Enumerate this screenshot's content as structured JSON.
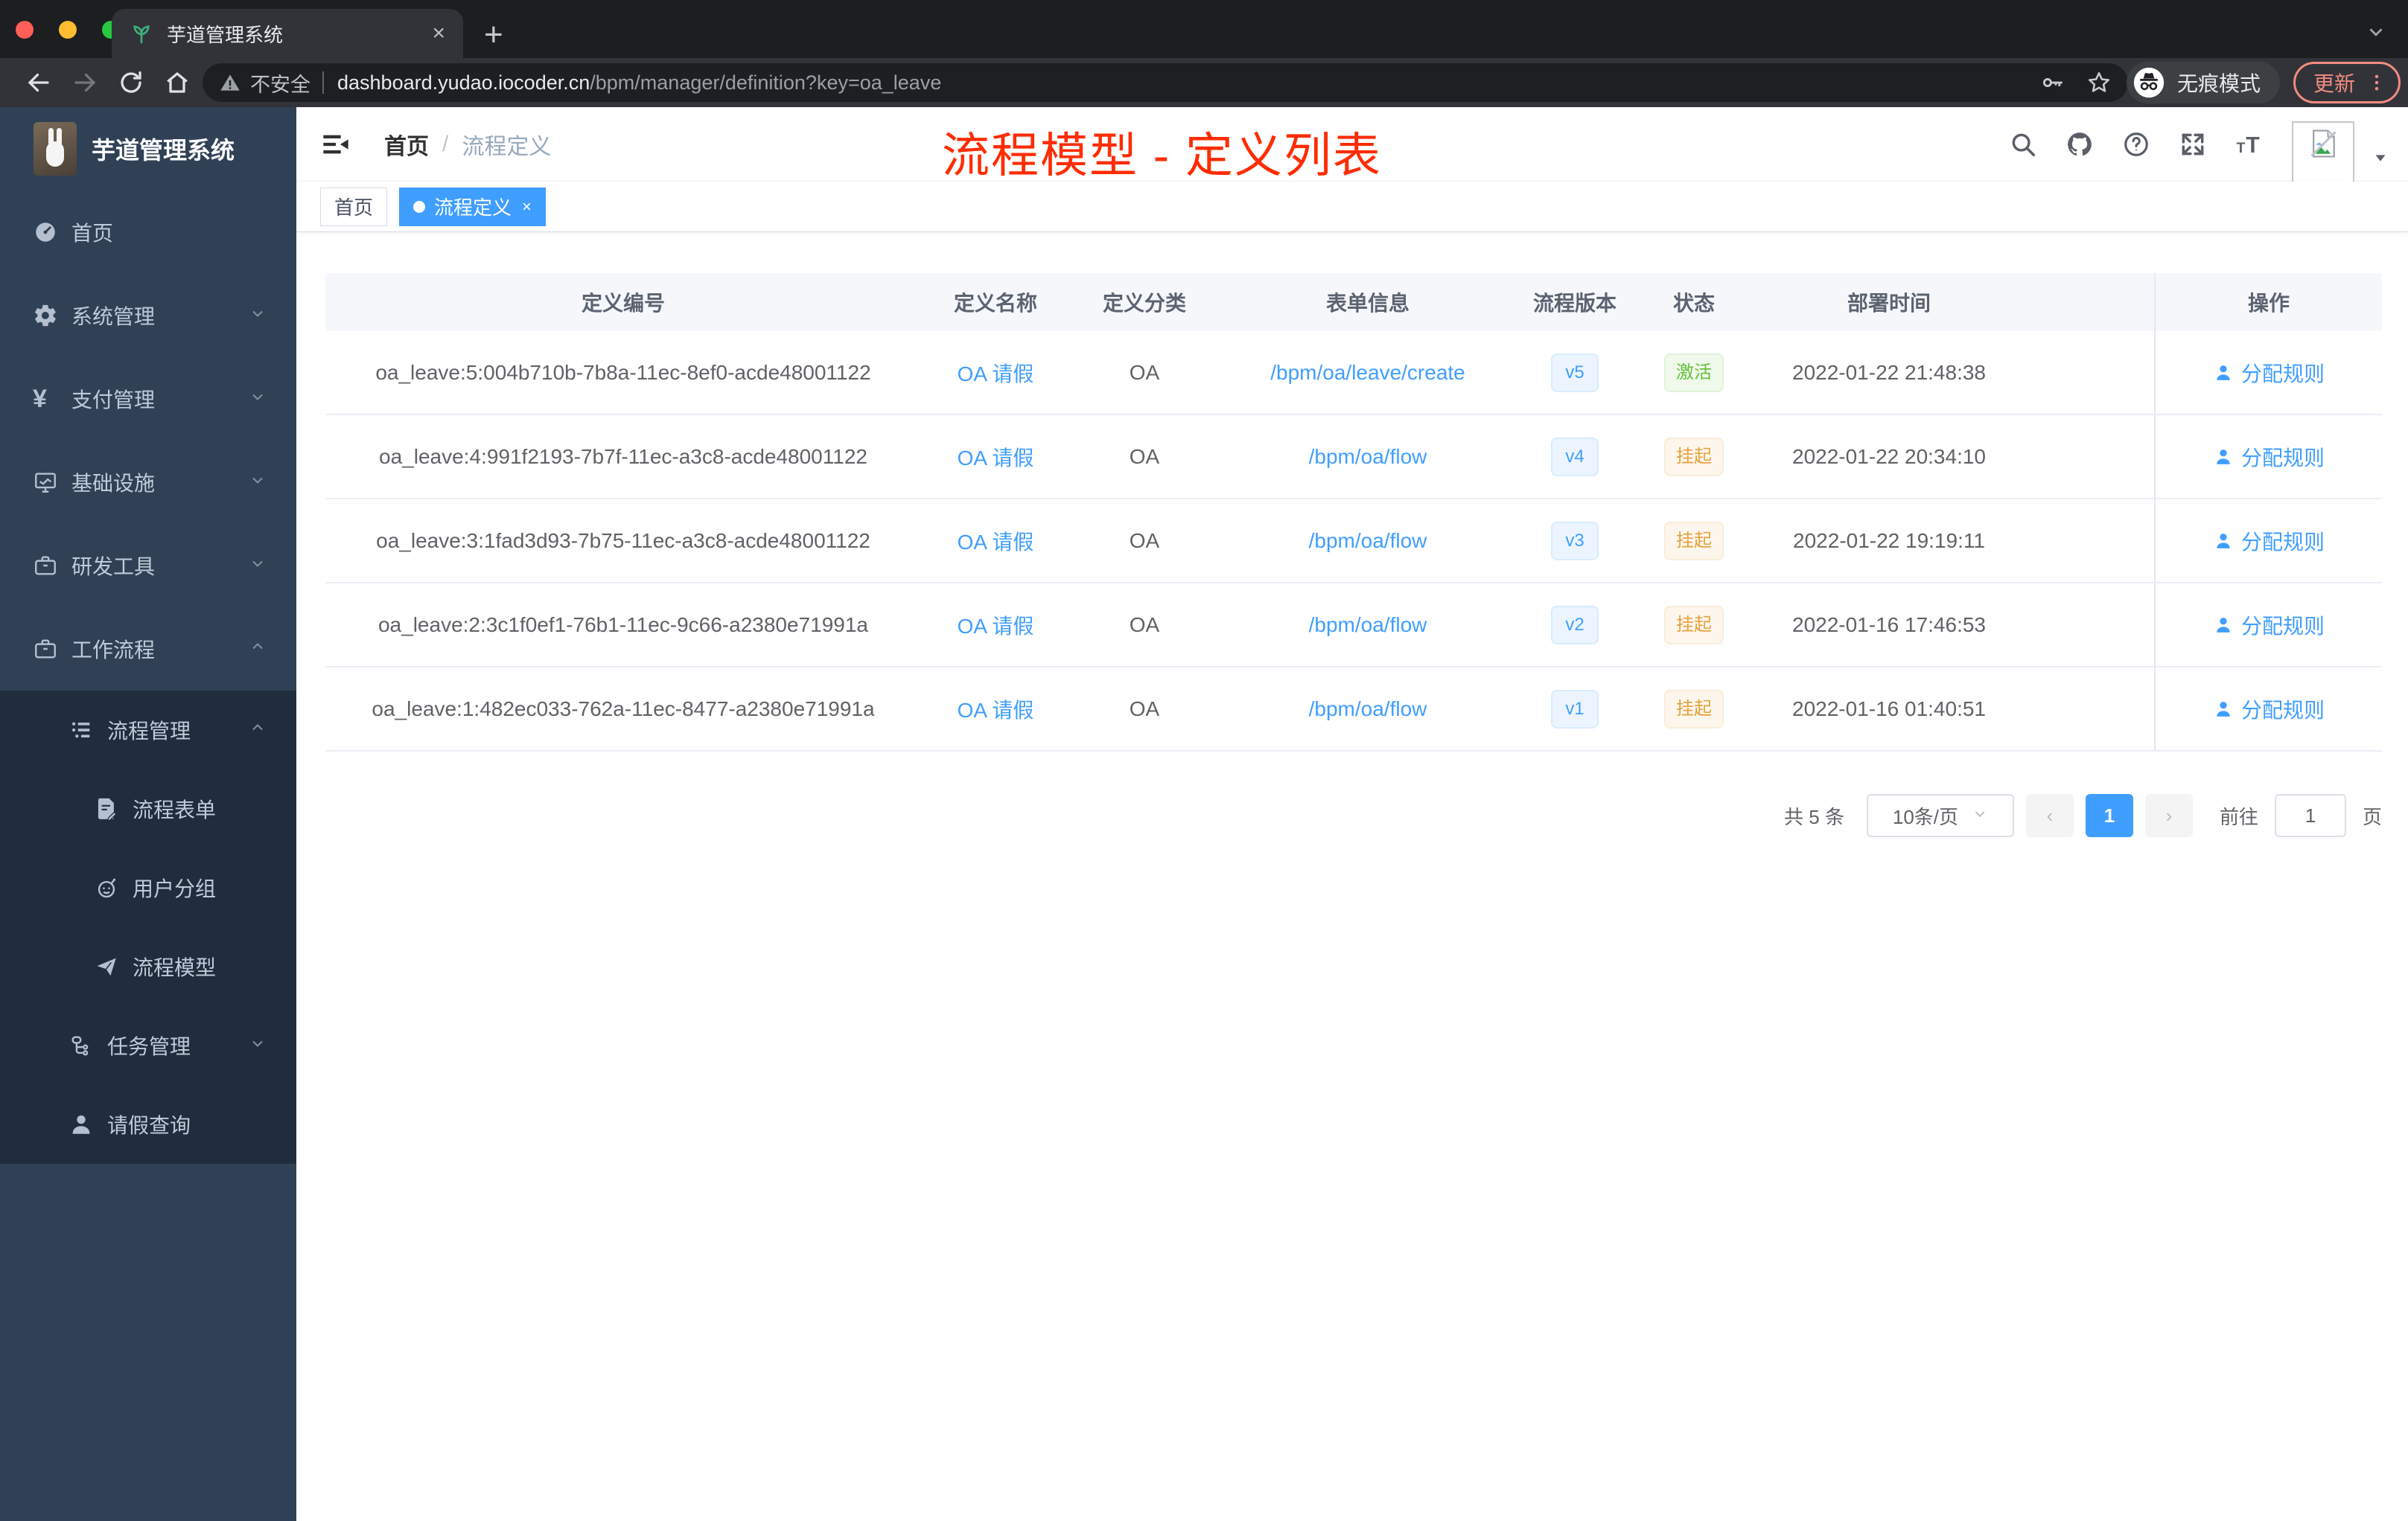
{
  "colors": {
    "accent": "#409eff",
    "annotation_red": "#fe2c01",
    "sidebar_bg": "#304156",
    "sidebar_sub_bg": "#1f2d3d",
    "status_active": "#67c23a",
    "status_suspend": "#e6a23c"
  },
  "browser": {
    "tab_title": "芋道管理系统",
    "security_label": "不安全",
    "url_domain": "dashboard.yudao.iocoder.cn",
    "url_path": "/bpm/manager/definition?key=oa_leave",
    "incognito_label": "无痕模式",
    "update_label": "更新"
  },
  "sidebar": {
    "app_title": "芋道管理系统",
    "items": [
      {
        "label": "首页",
        "icon": "gauge",
        "level": 0,
        "chevron": null,
        "section": "top"
      },
      {
        "label": "系统管理",
        "icon": "gear",
        "level": 0,
        "chevron": "down",
        "section": "top"
      },
      {
        "label": "支付管理",
        "icon": "yen",
        "level": 0,
        "chevron": "down",
        "section": "top"
      },
      {
        "label": "基础设施",
        "icon": "monitor",
        "level": 0,
        "chevron": "down",
        "section": "top"
      },
      {
        "label": "研发工具",
        "icon": "briefcase",
        "level": 0,
        "chevron": "down",
        "section": "top"
      },
      {
        "label": "工作流程",
        "icon": "briefcase",
        "level": 0,
        "chevron": "up",
        "section": "top"
      },
      {
        "label": "流程管理",
        "icon": "list",
        "level": 1,
        "chevron": "up",
        "section": "sub"
      },
      {
        "label": "流程表单",
        "icon": "form",
        "level": 2,
        "chevron": null,
        "section": "sub"
      },
      {
        "label": "用户分组",
        "icon": "robot",
        "level": 2,
        "chevron": null,
        "section": "sub"
      },
      {
        "label": "流程模型",
        "icon": "send",
        "level": 2,
        "chevron": null,
        "section": "sub"
      },
      {
        "label": "任务管理",
        "icon": "tree",
        "level": 1,
        "chevron": "down",
        "section": "sub"
      },
      {
        "label": "请假查询",
        "icon": "user",
        "level": 1,
        "chevron": null,
        "section": "sub"
      }
    ]
  },
  "header": {
    "breadcrumb_home": "首页",
    "breadcrumb_sep": "/",
    "breadcrumb_current": "流程定义",
    "annotation": "流程模型 - 定义列表"
  },
  "tags": {
    "home_label": "首页",
    "active_label": "流程定义",
    "close_glyph": "×"
  },
  "table": {
    "headers": [
      "定义编号",
      "定义名称",
      "定义分类",
      "表单信息",
      "流程版本",
      "状态",
      "部署时间",
      "操作"
    ],
    "action_label": "分配规则",
    "rows": [
      {
        "id": "oa_leave:5:004b710b-7b8a-11ec-8ef0-acde48001122",
        "name": "OA 请假",
        "category": "OA",
        "form": "/bpm/oa/leave/create",
        "version": "v5",
        "status": "激活",
        "status_type": "success",
        "time": "2022-01-22 21:48:38"
      },
      {
        "id": "oa_leave:4:991f2193-7b7f-11ec-a3c8-acde48001122",
        "name": "OA 请假",
        "category": "OA",
        "form": "/bpm/oa/flow",
        "version": "v4",
        "status": "挂起",
        "status_type": "warning",
        "time": "2022-01-22 20:34:10"
      },
      {
        "id": "oa_leave:3:1fad3d93-7b75-11ec-a3c8-acde48001122",
        "name": "OA 请假",
        "category": "OA",
        "form": "/bpm/oa/flow",
        "version": "v3",
        "status": "挂起",
        "status_type": "warning",
        "time": "2022-01-22 19:19:11"
      },
      {
        "id": "oa_leave:2:3c1f0ef1-76b1-11ec-9c66-a2380e71991a",
        "name": "OA 请假",
        "category": "OA",
        "form": "/bpm/oa/flow",
        "version": "v2",
        "status": "挂起",
        "status_type": "warning",
        "time": "2022-01-16 17:46:53"
      },
      {
        "id": "oa_leave:1:482ec033-762a-11ec-8477-a2380e71991a",
        "name": "OA 请假",
        "category": "OA",
        "form": "/bpm/oa/flow",
        "version": "v1",
        "status": "挂起",
        "status_type": "warning",
        "time": "2022-01-16 01:40:51"
      }
    ]
  },
  "pagination": {
    "total": "共 5 条",
    "page_size": "10条/页",
    "prev": "‹",
    "current": "1",
    "next": "›",
    "goto_label": "前往",
    "goto_value": "1",
    "page_unit": "页"
  }
}
